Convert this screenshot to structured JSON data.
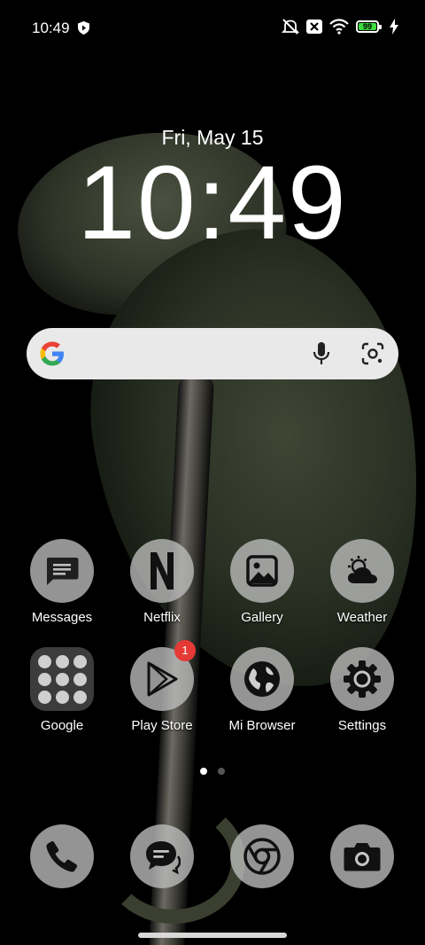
{
  "status_bar": {
    "time": "10:49",
    "battery": "99",
    "icons": [
      "shield-icon",
      "mute-icon",
      "close-box-icon",
      "wifi-icon",
      "battery-icon",
      "charging-icon"
    ]
  },
  "clock": {
    "date": "Fri, May 15",
    "time": "10:49"
  },
  "search": {
    "icons": [
      "google-logo",
      "microphone-icon",
      "lens-icon"
    ]
  },
  "apps_row1": [
    {
      "label": "Messages",
      "icon": "message-icon"
    },
    {
      "label": "Netflix",
      "icon": "netflix-icon"
    },
    {
      "label": "Gallery",
      "icon": "image-icon"
    },
    {
      "label": "Weather",
      "icon": "weather-icon"
    }
  ],
  "apps_row2": [
    {
      "label": "Google",
      "icon": "folder-icon"
    },
    {
      "label": "Play Store",
      "icon": "play-store-icon",
      "badge": "1"
    },
    {
      "label": "Mi Browser",
      "icon": "globe-icon"
    },
    {
      "label": "Settings",
      "icon": "gear-icon"
    }
  ],
  "dock": [
    {
      "icon": "phone-icon"
    },
    {
      "icon": "chat-icon"
    },
    {
      "icon": "chrome-icon"
    },
    {
      "icon": "camera-icon"
    }
  ],
  "colors": {
    "badge": "#e53935",
    "battery_fill": "#3ddc3d",
    "search_bg": "#e9e9e9"
  }
}
